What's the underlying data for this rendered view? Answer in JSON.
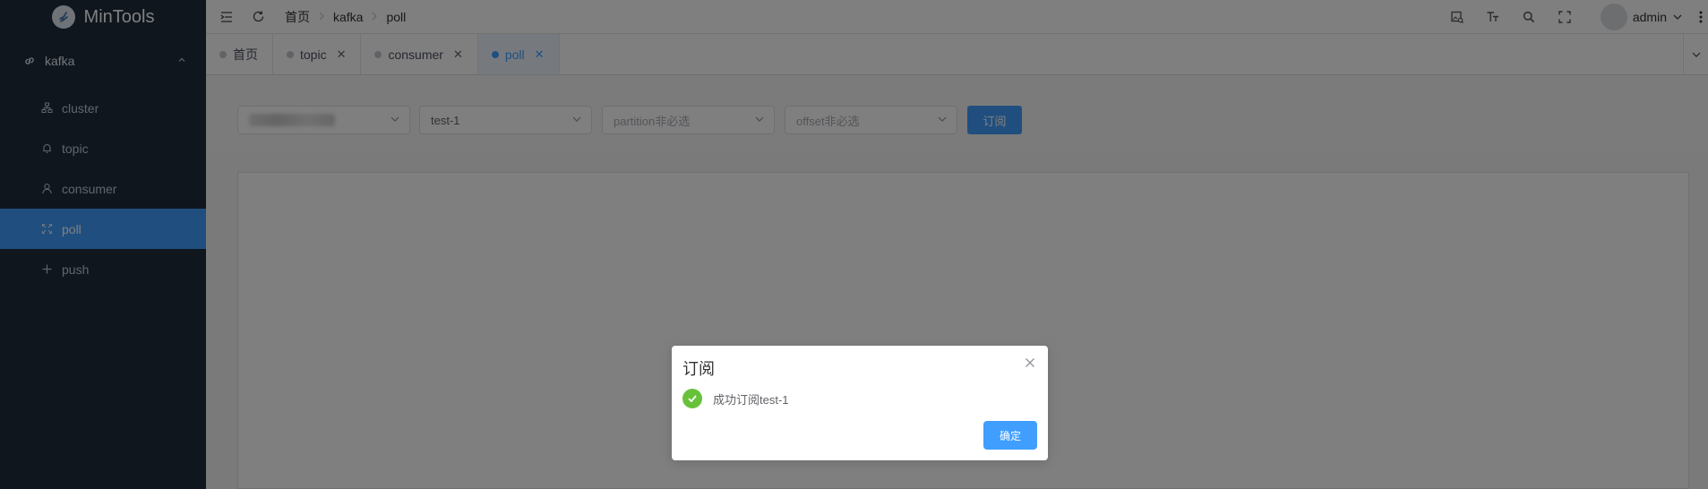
{
  "app": {
    "title": "MinTools"
  },
  "sidebar": {
    "group": {
      "label": "kafka"
    },
    "items": [
      {
        "label": "cluster",
        "icon": "cluster-icon"
      },
      {
        "label": "topic",
        "icon": "bell-icon"
      },
      {
        "label": "consumer",
        "icon": "user-icon"
      },
      {
        "label": "poll",
        "icon": "expand-icon",
        "active": true
      },
      {
        "label": "push",
        "icon": "plus-icon"
      }
    ]
  },
  "breadcrumb": [
    "首页",
    "kafka",
    "poll"
  ],
  "user": {
    "name": "admin"
  },
  "tags": [
    {
      "label": "首页"
    },
    {
      "label": "topic"
    },
    {
      "label": "consumer"
    },
    {
      "label": "poll",
      "active": true
    }
  ],
  "filters": {
    "cluster_value": "",
    "topic_value": "test-1",
    "partition_placeholder": "partition非必选",
    "offset_placeholder": "offset非必选",
    "subscribe_button": "订阅"
  },
  "dialog": {
    "title": "订阅",
    "message": "成功订阅test-1",
    "confirm": "确定"
  },
  "colors": {
    "primary": "#409eff",
    "success": "#67c23a",
    "sidebar": "#1f2d3d"
  }
}
